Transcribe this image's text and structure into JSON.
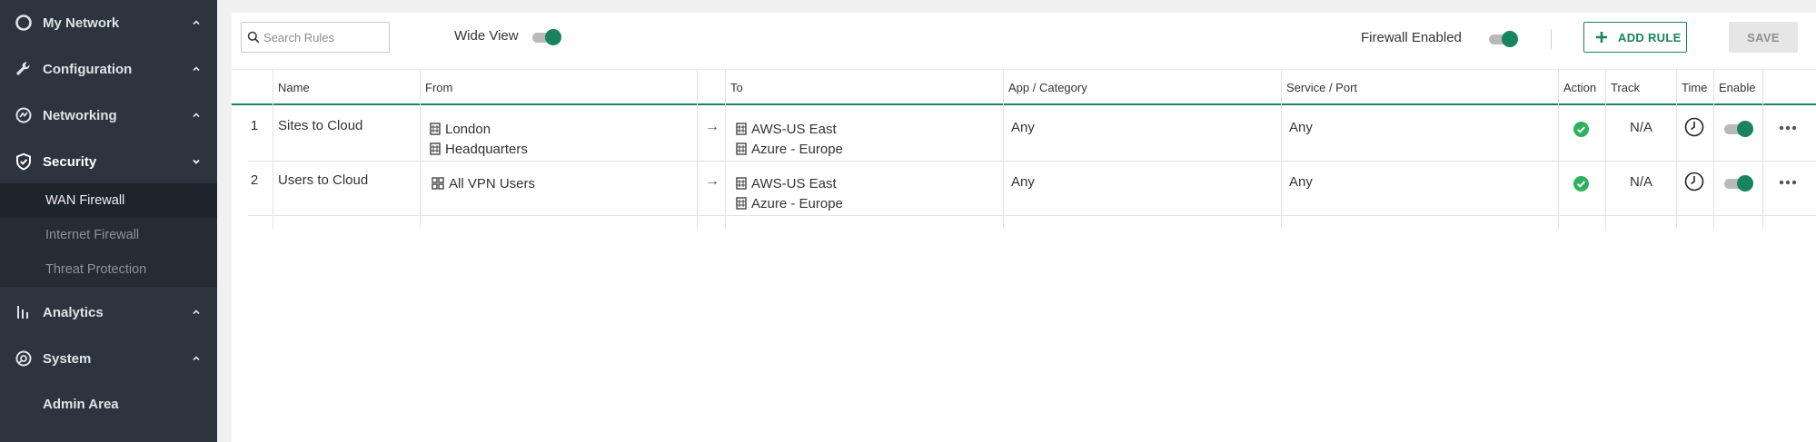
{
  "sidebar": {
    "items": [
      {
        "label": "My Network",
        "icon": "circle-icon"
      },
      {
        "label": "Configuration",
        "icon": "wrench-icon"
      },
      {
        "label": "Networking",
        "icon": "network-icon"
      },
      {
        "label": "Security",
        "icon": "shield-icon"
      },
      {
        "label": "Analytics",
        "icon": "bar-chart-icon"
      },
      {
        "label": "System",
        "icon": "system-icon"
      },
      {
        "label": "Admin Area"
      }
    ],
    "security_sub": [
      {
        "label": "WAN Firewall"
      },
      {
        "label": "Internet Firewall"
      },
      {
        "label": "Threat Protection"
      }
    ]
  },
  "toolbar": {
    "search_placeholder": "Search Rules",
    "wide_view_label": "Wide View",
    "firewall_enabled_label": "Firewall Enabled",
    "add_rule_label": "ADD RULE",
    "save_label": "SAVE"
  },
  "table": {
    "headers": {
      "name": "Name",
      "from": "From",
      "to": "To",
      "app": "App / Category",
      "service": "Service / Port",
      "action": "Action",
      "track": "Track",
      "time": "Time",
      "enable": "Enable"
    },
    "rows": [
      {
        "num": "1",
        "name": "Sites to Cloud",
        "from": [
          "London",
          "Headquarters"
        ],
        "arrow": "→",
        "to": [
          "AWS-US East",
          "Azure - Europe"
        ],
        "app": "Any",
        "service": "Any",
        "track": "N/A"
      },
      {
        "num": "2",
        "name": "Users to Cloud",
        "from": [
          "All VPN Users"
        ],
        "arrow": "→",
        "to": [
          "AWS-US East",
          "Azure - Europe"
        ],
        "app": "Any",
        "service": "Any",
        "track": "N/A"
      }
    ]
  },
  "colors": {
    "accent": "#17845f",
    "sidebar_bg": "#2c3440",
    "sidebar_active_sub": "#1e242c"
  }
}
